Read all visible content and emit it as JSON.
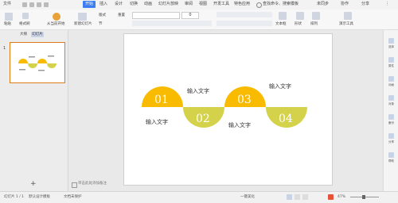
{
  "titlebar": {
    "file_menu": "文件",
    "tabs": [
      "开始",
      "插入",
      "设计",
      "切换",
      "动画",
      "幻灯片放映",
      "审阅",
      "视图",
      "开发工具",
      "特色应用"
    ],
    "search": "查找命令、搜索模板",
    "right_items": [
      "未同步",
      "协作",
      "分享"
    ]
  },
  "ribbon": {
    "labels": [
      "粘贴",
      "格式刷",
      "从当前开始",
      "新建幻灯片",
      "版式",
      "节",
      "重置",
      "文本框",
      "形状",
      "排列",
      "演示工具"
    ],
    "font_size": "0"
  },
  "sidebar": {
    "tabs": [
      "大纲",
      "幻灯片"
    ],
    "thumb_number": "1",
    "add_symbol": "+"
  },
  "notes_placeholder": "单击此处添加备注",
  "slide": {
    "numbers": [
      "01",
      "02",
      "03",
      "04"
    ],
    "captions": [
      "输入文字",
      "输入文字",
      "输入文字",
      "输入文字"
    ],
    "colors": {
      "yellow": "#f9bb00",
      "green": "#d4d24a"
    }
  },
  "status": {
    "slide_info": "幻灯片 1 / 1",
    "theme": "默认设计模板",
    "protect": "文档未保护",
    "notes": "一键美化",
    "zoom": "47%"
  },
  "right_panel": [
    "选择",
    "属性",
    "动画",
    "对象",
    "备份",
    "分享",
    "帮助"
  ]
}
